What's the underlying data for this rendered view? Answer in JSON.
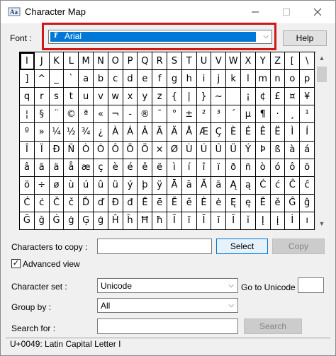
{
  "window": {
    "title": "Character Map",
    "minimize_icon": "minimize-icon",
    "maximize_icon": "maximize-icon",
    "close_icon": "close-icon"
  },
  "font": {
    "label": "Font :",
    "value": "Arial",
    "help_label": "Help",
    "highlight_color": "#d01616"
  },
  "grid": {
    "selected_index": 0,
    "rows": [
      [
        "I",
        "J",
        "K",
        "L",
        "M",
        "N",
        "O",
        "P",
        "Q",
        "R",
        "S",
        "T",
        "U",
        "V",
        "W",
        "X",
        "Y",
        "Z",
        "[",
        "\\"
      ],
      [
        "]",
        "^",
        "_",
        "`",
        "a",
        "b",
        "c",
        "d",
        "e",
        "f",
        "g",
        "h",
        "i",
        "j",
        "k",
        "l",
        "m",
        "n",
        "o",
        "p"
      ],
      [
        "q",
        "r",
        "s",
        "t",
        "u",
        "v",
        "w",
        "x",
        "y",
        "z",
        "{",
        "|",
        "}",
        "~",
        " ",
        "¡",
        "¢",
        "£",
        "¤",
        "¥"
      ],
      [
        "¦",
        "§",
        "¨",
        "©",
        "ª",
        "«",
        "¬",
        "-",
        "®",
        "¯",
        "°",
        "±",
        "²",
        "³",
        "´",
        "µ",
        "¶",
        "·",
        "¸",
        "¹"
      ],
      [
        "º",
        "»",
        "¼",
        "½",
        "¾",
        "¿",
        "À",
        "Á",
        "Â",
        "Ã",
        "Ä",
        "Å",
        "Æ",
        "Ç",
        "È",
        "É",
        "Ê",
        "Ë",
        "Ì",
        "Í"
      ],
      [
        "Î",
        "Ï",
        "Ð",
        "Ñ",
        "Ò",
        "Ó",
        "Ô",
        "Õ",
        "Ö",
        "×",
        "Ø",
        "Ù",
        "Ú",
        "Û",
        "Ü",
        "Ý",
        "Þ",
        "ß",
        "à",
        "á"
      ],
      [
        "â",
        "ã",
        "ä",
        "å",
        "æ",
        "ç",
        "è",
        "é",
        "ê",
        "ë",
        "ì",
        "í",
        "î",
        "ï",
        "ð",
        "ñ",
        "ò",
        "ó",
        "ô",
        "õ"
      ],
      [
        "ö",
        "÷",
        "ø",
        "ù",
        "ú",
        "û",
        "ü",
        "ý",
        "þ",
        "ÿ",
        "Ā",
        "ā",
        "Ă",
        "ă",
        "Ą",
        "ą",
        "Ć",
        "ć",
        "Ĉ",
        "ĉ"
      ],
      [
        "Ċ",
        "ċ",
        "Č",
        "č",
        "Ď",
        "ď",
        "Đ",
        "đ",
        "Ē",
        "ē",
        "Ĕ",
        "ĕ",
        "Ė",
        "ė",
        "Ę",
        "ę",
        "Ě",
        "ě",
        "Ĝ",
        "ĝ"
      ],
      [
        "Ğ",
        "ğ",
        "Ġ",
        "ġ",
        "Ģ",
        "ģ",
        "Ĥ",
        "ĥ",
        "Ħ",
        "ħ",
        "Ĩ",
        "ĩ",
        "Ī",
        "ī",
        "Ĭ",
        "ĭ",
        "Į",
        "į",
        "İ",
        "ı"
      ]
    ]
  },
  "copy": {
    "label": "Characters to copy :",
    "value": "",
    "select_label": "Select",
    "copy_label": "Copy"
  },
  "advanced": {
    "label": "Advanced view",
    "checked": true,
    "check_mark": "✓"
  },
  "charset": {
    "label": "Character set :",
    "value": "Unicode",
    "goto_label": "Go to Unicode :",
    "goto_value": ""
  },
  "groupby": {
    "label": "Group by :",
    "value": "All"
  },
  "search": {
    "label": "Search for :",
    "value": "",
    "button_label": "Search"
  },
  "status": {
    "text": "U+0049: Latin Capital Letter I"
  },
  "icons": {
    "app": "character-map-icon",
    "dropdown": "chevron-down-icon",
    "scroll_up": "scroll-up-arrow-icon",
    "scroll_down": "scroll-down-arrow-icon"
  }
}
